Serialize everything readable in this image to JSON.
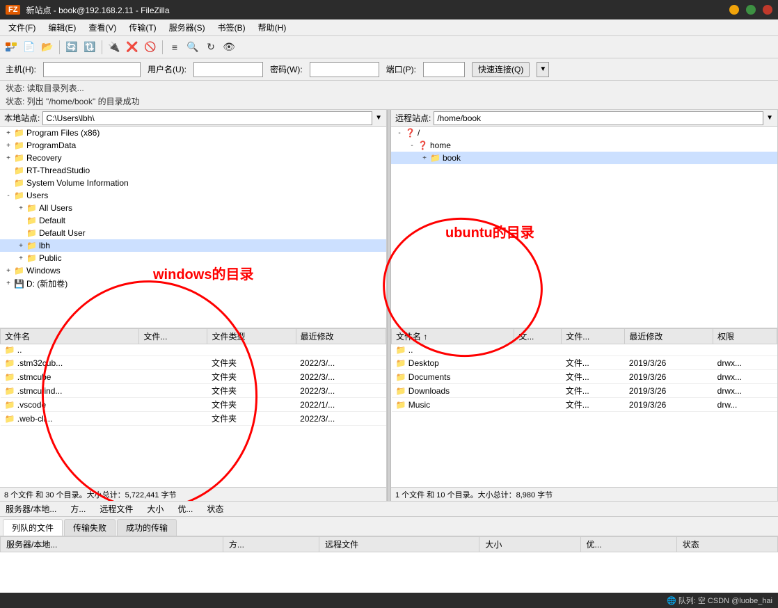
{
  "titlebar": {
    "logo": "FZ",
    "title": "新站点 - book@192.168.2.11 - FileZilla",
    "minimize": "●",
    "maximize": "●",
    "close": "●"
  },
  "menu": {
    "items": [
      "文件(F)",
      "编辑(E)",
      "查看(V)",
      "传输(T)",
      "服务器(S)",
      "书签(B)",
      "帮助(H)"
    ]
  },
  "addressbar": {
    "host_label": "主机(H):",
    "user_label": "用户名(U):",
    "pass_label": "密码(W):",
    "port_label": "端口(P):",
    "quickconnect": "快速连接(Q)"
  },
  "status": {
    "line1": "状态: 读取目录列表...",
    "line2": "状态: 列出 \"/home/book\" 的目录成功"
  },
  "local_panel": {
    "label": "本地站点:",
    "path": "C:\\Users\\lbh\\",
    "tree": [
      {
        "indent": 0,
        "expanded": false,
        "icon": "yellow",
        "name": "Program Files (x86)",
        "prefix": "+"
      },
      {
        "indent": 0,
        "expanded": false,
        "icon": "yellow",
        "name": "ProgramData",
        "prefix": "+"
      },
      {
        "indent": 0,
        "expanded": false,
        "icon": "yellow",
        "name": "Recovery",
        "prefix": "+"
      },
      {
        "indent": 0,
        "expanded": false,
        "icon": "yellow",
        "name": "RT-ThreadStudio",
        "prefix": ""
      },
      {
        "indent": 0,
        "expanded": false,
        "icon": "yellow",
        "name": "System Volume Information",
        "prefix": ""
      },
      {
        "indent": 0,
        "expanded": true,
        "icon": "yellow",
        "name": "Users",
        "prefix": "-"
      },
      {
        "indent": 1,
        "expanded": false,
        "icon": "yellow",
        "name": "All Users",
        "prefix": "+"
      },
      {
        "indent": 1,
        "expanded": false,
        "icon": "yellow",
        "name": "Default",
        "prefix": ""
      },
      {
        "indent": 1,
        "expanded": false,
        "icon": "yellow",
        "name": "Default User",
        "prefix": ""
      },
      {
        "indent": 1,
        "expanded": false,
        "icon": "purple",
        "name": "lbh",
        "prefix": "+"
      },
      {
        "indent": 1,
        "expanded": false,
        "icon": "yellow",
        "name": "Public",
        "prefix": "+"
      },
      {
        "indent": 0,
        "expanded": false,
        "icon": "yellow",
        "name": "Windows",
        "prefix": "+"
      },
      {
        "indent": 0,
        "expanded": false,
        "icon": "drive",
        "name": "D: (新加卷)",
        "prefix": "+"
      }
    ],
    "files": {
      "columns": [
        "文件名",
        "文件...",
        "文件类型",
        "最近修改"
      ],
      "rows": [
        {
          "name": "..",
          "size": "",
          "type": "",
          "date": ""
        },
        {
          "name": ".stm32cub...",
          "size": "",
          "type": "文件夹",
          "date": "2022/3/..."
        },
        {
          "name": ".stmcube",
          "size": "",
          "type": "文件夹",
          "date": "2022/3/..."
        },
        {
          "name": ".stmcufind...",
          "size": "",
          "type": "文件夹",
          "date": "2022/3/..."
        },
        {
          "name": ".vscode",
          "size": "",
          "type": "文件夹",
          "date": "2022/1/..."
        },
        {
          "name": ".web-cli...",
          "size": "",
          "type": "文件夹",
          "date": "2022/3/..."
        }
      ]
    },
    "summary": "8 个文件 和 30 个目录。大小总计：5,722,441 字节"
  },
  "remote_panel": {
    "label": "远程站点:",
    "path": "/home/book",
    "tree": [
      {
        "indent": 0,
        "expanded": true,
        "icon": "question",
        "name": "/",
        "prefix": "-"
      },
      {
        "indent": 1,
        "expanded": true,
        "icon": "question",
        "name": "home",
        "prefix": "-"
      },
      {
        "indent": 2,
        "expanded": false,
        "icon": "purple",
        "name": "book",
        "prefix": "+"
      }
    ],
    "files": {
      "columns": [
        "文件名",
        "文...",
        "文件...",
        "最近修改",
        "权限"
      ],
      "rows": [
        {
          "name": "..",
          "size": "",
          "type": "",
          "date": "",
          "perm": ""
        },
        {
          "name": "Desktop",
          "size": "",
          "type": "文件...",
          "date": "2019/3/26",
          "perm": "drwx..."
        },
        {
          "name": "Documents",
          "size": "",
          "type": "文件...",
          "date": "2019/3/26",
          "perm": "drwx..."
        },
        {
          "name": "Downloads",
          "size": "",
          "type": "文件...",
          "date": "2019/3/26",
          "perm": "drwx..."
        },
        {
          "name": "Music",
          "size": "",
          "type": "文件...",
          "date": "2019/3/26",
          "perm": "drw..."
        }
      ]
    },
    "summary": "1 个文件 和 10 个目录。大小总计：8,980 字节"
  },
  "bottom_status": {
    "col1": "服务器/本地...",
    "col2": "方...",
    "col3": "远程文件",
    "col4": "大小",
    "col5": "优...",
    "col6": "状态"
  },
  "transfer_tabs": {
    "tab1": "列队的文件",
    "tab2": "传输失败",
    "tab3": "成功的传输"
  },
  "system_bar": {
    "left": "",
    "right": "🌐 队列: 空   CSDN @luobe_hai"
  },
  "annotations": {
    "windows": "windows的目录",
    "ubuntu": "ubuntu的目录"
  }
}
